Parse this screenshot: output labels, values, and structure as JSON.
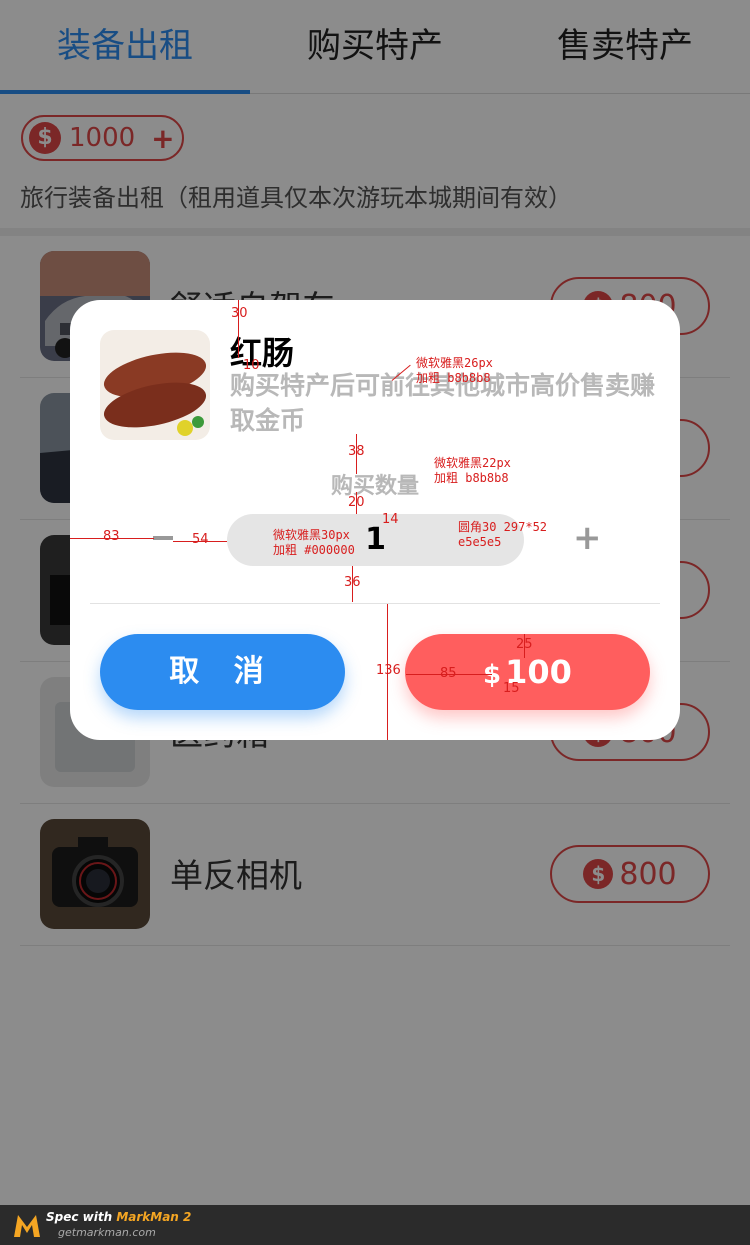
{
  "tabs": [
    {
      "label": "装备出租"
    },
    {
      "label": "购买特产"
    },
    {
      "label": "售卖特产"
    }
  ],
  "balance": {
    "symbol": "$",
    "value": "1000",
    "add": "+"
  },
  "subtitle": "旅行装备出租（租用道具仅本次游玩本城期间有效）",
  "items": [
    {
      "name": "舒适自驾车",
      "price": "800",
      "symbol": "$"
    },
    {
      "name": "",
      "price": "",
      "symbol": ""
    },
    {
      "name": "",
      "price": "",
      "symbol": ""
    },
    {
      "name": "医药箱",
      "price": "800",
      "symbol": "$"
    },
    {
      "name": "单反相机",
      "price": "800",
      "symbol": "$"
    }
  ],
  "modal": {
    "title": "红肠",
    "description": "购买特产后可前往其他城市高价售卖赚取金币",
    "quantity_label": "购买数量",
    "minus": "−",
    "quantity": "1",
    "plus": "+",
    "cancel": "取 消",
    "buy_symbol": "$",
    "buy_price": "100"
  },
  "annotations": {
    "title_top": "30",
    "title_gap": "10",
    "desc_font": "微软雅黑26px",
    "desc_weight": "加粗 b8b8b8",
    "qty_font": "微软雅黑22px",
    "qty_weight": "加粗 b8b8b8",
    "gap_38": "38",
    "gap_20": "20",
    "gap_14": "14",
    "left_83": "83",
    "gap_54": "54",
    "box_font": "微软雅黑30px",
    "box_weight": "加粗 #000000",
    "box_radius": "圆角30 297*52",
    "box_color": "e5e5e5",
    "gap_36": "36",
    "height_136": "136",
    "gap_85": "85",
    "gap_25": "25",
    "gap_15": "15"
  },
  "footer": {
    "spec": "Spec with",
    "brand": "MarkMan 2",
    "url": "getmarkman.com"
  },
  "colors": {
    "primary": "#2c8cf0",
    "danger": "#e04848",
    "buy": "#ff5e5e",
    "annotation": "#d81e1e"
  }
}
